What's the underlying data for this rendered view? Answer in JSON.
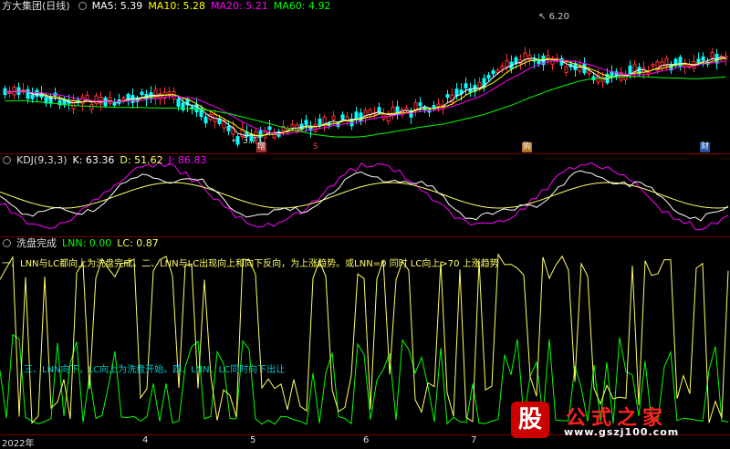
{
  "colors": {
    "ma5": "#ffffff",
    "ma10": "#ffff00",
    "ma20": "#ff00ff",
    "ma60": "#00ff00",
    "k": "#ffffff",
    "d": "#ffff66",
    "j": "#ff00ff",
    "lnn": "#00ff00",
    "lc": "#ffff66",
    "up": "#ff3030",
    "down": "#00ffff"
  },
  "price_panel": {
    "title": "方大集团(日线)",
    "ma5": "MA5: 5.39",
    "ma10": "MA10: 5.28",
    "ma20": "MA20: 5.21",
    "ma60": "MA60: 4.92",
    "high_label": "6.20",
    "low_label": "3.71",
    "badges": [
      "增",
      "S",
      "购",
      "财"
    ]
  },
  "kdj_panel": {
    "name": "KDJ(9,3,3)",
    "k": "K: 63.36",
    "d": "D: 51.62",
    "j": "J: 86.83"
  },
  "wash_panel": {
    "name": "洗盘完成",
    "lnn": "LNN: 0.00",
    "lc": "LC: 0.87",
    "note1": "一、LNN与LC都向上为洗盘完成。二、LNN与LC出现向上和向下反向，为上涨趋势。或LNN=0 同时 LC向上>70 上涨趋势",
    "note2": "三、LNN向下，LC向上为洗盘开始。四、LNN、LC同时向下出让"
  },
  "x_axis": {
    "labels": [
      "2022年",
      "4",
      "5",
      "6",
      "7"
    ]
  },
  "watermark": {
    "logo_char": "股",
    "title": "公式之家",
    "url": "www.gszj100.com"
  }
}
